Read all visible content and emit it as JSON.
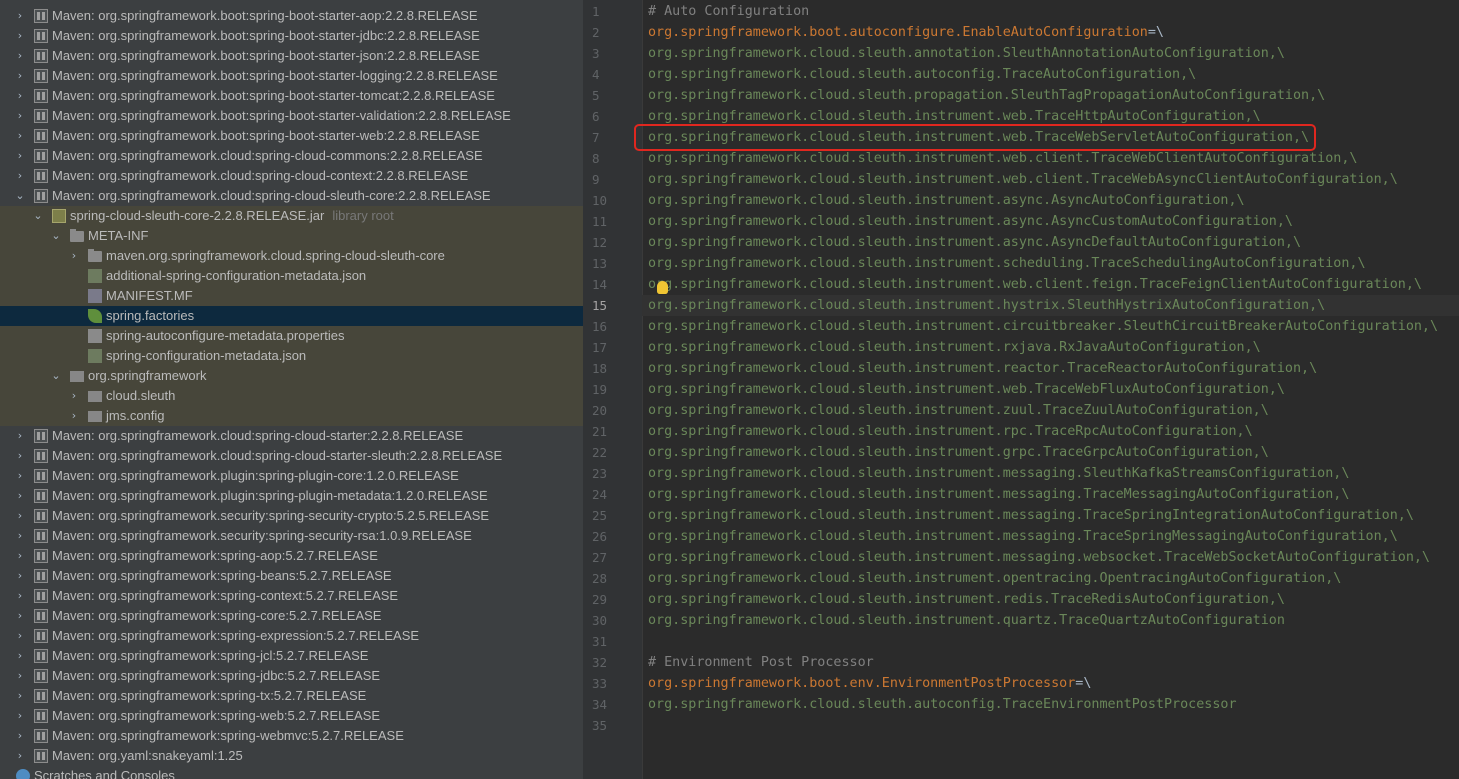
{
  "project_tree": {
    "rows": [
      {
        "text": "Maven: org.springframework.boot:spring-boot-starter-aop:2.2.8.RELEASE",
        "kind": "lib",
        "depth": 0,
        "arrow": "›"
      },
      {
        "text": "Maven: org.springframework.boot:spring-boot-starter-jdbc:2.2.8.RELEASE",
        "kind": "lib",
        "depth": 0,
        "arrow": "›"
      },
      {
        "text": "Maven: org.springframework.boot:spring-boot-starter-json:2.2.8.RELEASE",
        "kind": "lib",
        "depth": 0,
        "arrow": "›"
      },
      {
        "text": "Maven: org.springframework.boot:spring-boot-starter-logging:2.2.8.RELEASE",
        "kind": "lib",
        "depth": 0,
        "arrow": "›"
      },
      {
        "text": "Maven: org.springframework.boot:spring-boot-starter-tomcat:2.2.8.RELEASE",
        "kind": "lib",
        "depth": 0,
        "arrow": "›"
      },
      {
        "text": "Maven: org.springframework.boot:spring-boot-starter-validation:2.2.8.RELEASE",
        "kind": "lib",
        "depth": 0,
        "arrow": "›"
      },
      {
        "text": "Maven: org.springframework.boot:spring-boot-starter-web:2.2.8.RELEASE",
        "kind": "lib",
        "depth": 0,
        "arrow": "›"
      },
      {
        "text": "Maven: org.springframework.cloud:spring-cloud-commons:2.2.8.RELEASE",
        "kind": "lib",
        "depth": 0,
        "arrow": "›"
      },
      {
        "text": "Maven: org.springframework.cloud:spring-cloud-context:2.2.8.RELEASE",
        "kind": "lib",
        "depth": 0,
        "arrow": "›"
      },
      {
        "text": "Maven: org.springframework.cloud:spring-cloud-sleuth-core:2.2.8.RELEASE",
        "kind": "lib",
        "depth": 0,
        "arrow": "⌄"
      },
      {
        "text": "spring-cloud-sleuth-core-2.2.8.RELEASE.jar",
        "hint": "library root",
        "kind": "jar",
        "depth": 1,
        "arrow": "⌄",
        "bg": "lib"
      },
      {
        "text": "META-INF",
        "kind": "folder",
        "depth": 2,
        "arrow": "⌄",
        "bg": "lib"
      },
      {
        "text": "maven.org.springframework.cloud.spring-cloud-sleuth-core",
        "kind": "folder",
        "depth": 3,
        "arrow": "›",
        "bg": "lib"
      },
      {
        "text": "additional-spring-configuration-metadata.json",
        "kind": "json",
        "depth": 3,
        "arrow": "",
        "bg": "lib"
      },
      {
        "text": "MANIFEST.MF",
        "kind": "mf",
        "depth": 3,
        "arrow": "",
        "bg": "lib"
      },
      {
        "text": "spring.factories",
        "kind": "leaf",
        "depth": 3,
        "arrow": "",
        "bg": "selected"
      },
      {
        "text": "spring-autoconfigure-metadata.properties",
        "kind": "props",
        "depth": 3,
        "arrow": "",
        "bg": "lib"
      },
      {
        "text": "spring-configuration-metadata.json",
        "kind": "json",
        "depth": 3,
        "arrow": "",
        "bg": "lib"
      },
      {
        "text": "org.springframework",
        "kind": "pkg",
        "depth": 2,
        "arrow": "⌄",
        "bg": "lib"
      },
      {
        "text": "cloud.sleuth",
        "kind": "pkg",
        "depth": 3,
        "arrow": "›",
        "bg": "lib"
      },
      {
        "text": "jms.config",
        "kind": "pkg",
        "depth": 3,
        "arrow": "›",
        "bg": "lib"
      },
      {
        "text": "Maven: org.springframework.cloud:spring-cloud-starter:2.2.8.RELEASE",
        "kind": "lib",
        "depth": 0,
        "arrow": "›"
      },
      {
        "text": "Maven: org.springframework.cloud:spring-cloud-starter-sleuth:2.2.8.RELEASE",
        "kind": "lib",
        "depth": 0,
        "arrow": "›"
      },
      {
        "text": "Maven: org.springframework.plugin:spring-plugin-core:1.2.0.RELEASE",
        "kind": "lib",
        "depth": 0,
        "arrow": "›"
      },
      {
        "text": "Maven: org.springframework.plugin:spring-plugin-metadata:1.2.0.RELEASE",
        "kind": "lib",
        "depth": 0,
        "arrow": "›"
      },
      {
        "text": "Maven: org.springframework.security:spring-security-crypto:5.2.5.RELEASE",
        "kind": "lib",
        "depth": 0,
        "arrow": "›"
      },
      {
        "text": "Maven: org.springframework.security:spring-security-rsa:1.0.9.RELEASE",
        "kind": "lib",
        "depth": 0,
        "arrow": "›"
      },
      {
        "text": "Maven: org.springframework:spring-aop:5.2.7.RELEASE",
        "kind": "lib",
        "depth": 0,
        "arrow": "›"
      },
      {
        "text": "Maven: org.springframework:spring-beans:5.2.7.RELEASE",
        "kind": "lib",
        "depth": 0,
        "arrow": "›"
      },
      {
        "text": "Maven: org.springframework:spring-context:5.2.7.RELEASE",
        "kind": "lib",
        "depth": 0,
        "arrow": "›"
      },
      {
        "text": "Maven: org.springframework:spring-core:5.2.7.RELEASE",
        "kind": "lib",
        "depth": 0,
        "arrow": "›"
      },
      {
        "text": "Maven: org.springframework:spring-expression:5.2.7.RELEASE",
        "kind": "lib",
        "depth": 0,
        "arrow": "›"
      },
      {
        "text": "Maven: org.springframework:spring-jcl:5.2.7.RELEASE",
        "kind": "lib",
        "depth": 0,
        "arrow": "›"
      },
      {
        "text": "Maven: org.springframework:spring-jdbc:5.2.7.RELEASE",
        "kind": "lib",
        "depth": 0,
        "arrow": "›"
      },
      {
        "text": "Maven: org.springframework:spring-tx:5.2.7.RELEASE",
        "kind": "lib",
        "depth": 0,
        "arrow": "›"
      },
      {
        "text": "Maven: org.springframework:spring-web:5.2.7.RELEASE",
        "kind": "lib",
        "depth": 0,
        "arrow": "›"
      },
      {
        "text": "Maven: org.springframework:spring-webmvc:5.2.7.RELEASE",
        "kind": "lib",
        "depth": 0,
        "arrow": "›"
      },
      {
        "text": "Maven: org.yaml:snakeyaml:1.25",
        "kind": "lib",
        "depth": 0,
        "arrow": "›"
      },
      {
        "text": "Scratches and Consoles",
        "kind": "scratch",
        "depth": -1,
        "arrow": ""
      }
    ]
  },
  "editor": {
    "current_line": 15,
    "highlighted_line": 7,
    "lines": [
      {
        "n": "1",
        "type": "comment",
        "text": "# Auto Configuration"
      },
      {
        "n": "2",
        "type": "key",
        "text": "org.springframework.boot.autoconfigure.EnableAutoConfiguration",
        "tail": "=\\"
      },
      {
        "n": "3",
        "type": "val",
        "text": "org.springframework.cloud.sleuth.annotation.SleuthAnnotationAutoConfiguration,\\"
      },
      {
        "n": "4",
        "type": "val",
        "text": "org.springframework.cloud.sleuth.autoconfig.TraceAutoConfiguration,\\"
      },
      {
        "n": "5",
        "type": "val",
        "text": "org.springframework.cloud.sleuth.propagation.SleuthTagPropagationAutoConfiguration,\\"
      },
      {
        "n": "6",
        "type": "val",
        "text": "org.springframework.cloud.sleuth.instrument.web.TraceHttpAutoConfiguration,\\"
      },
      {
        "n": "7",
        "type": "val",
        "text": "org.springframework.cloud.sleuth.instrument.web.TraceWebServletAutoConfiguration,\\"
      },
      {
        "n": "8",
        "type": "val",
        "text": "org.springframework.cloud.sleuth.instrument.web.client.TraceWebClientAutoConfiguration,\\"
      },
      {
        "n": "9",
        "type": "val",
        "text": "org.springframework.cloud.sleuth.instrument.web.client.TraceWebAsyncClientAutoConfiguration,\\"
      },
      {
        "n": "10",
        "type": "val",
        "text": "org.springframework.cloud.sleuth.instrument.async.AsyncAutoConfiguration,\\"
      },
      {
        "n": "11",
        "type": "val",
        "text": "org.springframework.cloud.sleuth.instrument.async.AsyncCustomAutoConfiguration,\\"
      },
      {
        "n": "12",
        "type": "val",
        "text": "org.springframework.cloud.sleuth.instrument.async.AsyncDefaultAutoConfiguration,\\"
      },
      {
        "n": "13",
        "type": "val",
        "text": "org.springframework.cloud.sleuth.instrument.scheduling.TraceSchedulingAutoConfiguration,\\"
      },
      {
        "n": "14",
        "type": "val",
        "text": "org.springframework.cloud.sleuth.instrument.web.client.feign.TraceFeignClientAutoConfiguration,\\"
      },
      {
        "n": "15",
        "type": "val",
        "text": "org.springframework.cloud.sleuth.instrument.hystrix.SleuthHystrixAutoConfiguration,\\"
      },
      {
        "n": "16",
        "type": "val",
        "text": "org.springframework.cloud.sleuth.instrument.circuitbreaker.SleuthCircuitBreakerAutoConfiguration,\\"
      },
      {
        "n": "17",
        "type": "val",
        "text": "org.springframework.cloud.sleuth.instrument.rxjava.RxJavaAutoConfiguration,\\"
      },
      {
        "n": "18",
        "type": "val",
        "text": "org.springframework.cloud.sleuth.instrument.reactor.TraceReactorAutoConfiguration,\\"
      },
      {
        "n": "19",
        "type": "val",
        "text": "org.springframework.cloud.sleuth.instrument.web.TraceWebFluxAutoConfiguration,\\"
      },
      {
        "n": "20",
        "type": "val",
        "text": "org.springframework.cloud.sleuth.instrument.zuul.TraceZuulAutoConfiguration,\\"
      },
      {
        "n": "21",
        "type": "val",
        "text": "org.springframework.cloud.sleuth.instrument.rpc.TraceRpcAutoConfiguration,\\"
      },
      {
        "n": "22",
        "type": "val",
        "text": "org.springframework.cloud.sleuth.instrument.grpc.TraceGrpcAutoConfiguration,\\"
      },
      {
        "n": "23",
        "type": "val",
        "text": "org.springframework.cloud.sleuth.instrument.messaging.SleuthKafkaStreamsConfiguration,\\"
      },
      {
        "n": "24",
        "type": "val",
        "text": "org.springframework.cloud.sleuth.instrument.messaging.TraceMessagingAutoConfiguration,\\"
      },
      {
        "n": "25",
        "type": "val",
        "text": "org.springframework.cloud.sleuth.instrument.messaging.TraceSpringIntegrationAutoConfiguration,\\"
      },
      {
        "n": "26",
        "type": "val",
        "text": "org.springframework.cloud.sleuth.instrument.messaging.TraceSpringMessagingAutoConfiguration,\\"
      },
      {
        "n": "27",
        "type": "val",
        "text": "org.springframework.cloud.sleuth.instrument.messaging.websocket.TraceWebSocketAutoConfiguration,\\"
      },
      {
        "n": "28",
        "type": "val",
        "text": "org.springframework.cloud.sleuth.instrument.opentracing.OpentracingAutoConfiguration,\\"
      },
      {
        "n": "29",
        "type": "val",
        "text": "org.springframework.cloud.sleuth.instrument.redis.TraceRedisAutoConfiguration,\\"
      },
      {
        "n": "30",
        "type": "val",
        "text": "org.springframework.cloud.sleuth.instrument.quartz.TraceQuartzAutoConfiguration"
      },
      {
        "n": "31",
        "type": "blank",
        "text": ""
      },
      {
        "n": "32",
        "type": "comment",
        "text": "# Environment Post Processor"
      },
      {
        "n": "33",
        "type": "key",
        "text": "org.springframework.boot.env.EnvironmentPostProcessor",
        "tail": "=\\"
      },
      {
        "n": "34",
        "type": "val",
        "text": "org.springframework.cloud.sleuth.autoconfig.TraceEnvironmentPostProcessor"
      },
      {
        "n": "35",
        "type": "blank",
        "text": ""
      }
    ]
  },
  "colors": {
    "highlight_box": "#e0271f",
    "comment": "#808080",
    "key": "#cc7832",
    "value": "#6a8759"
  },
  "icons": {
    "gutter_marker": "lightbulb-icon"
  }
}
